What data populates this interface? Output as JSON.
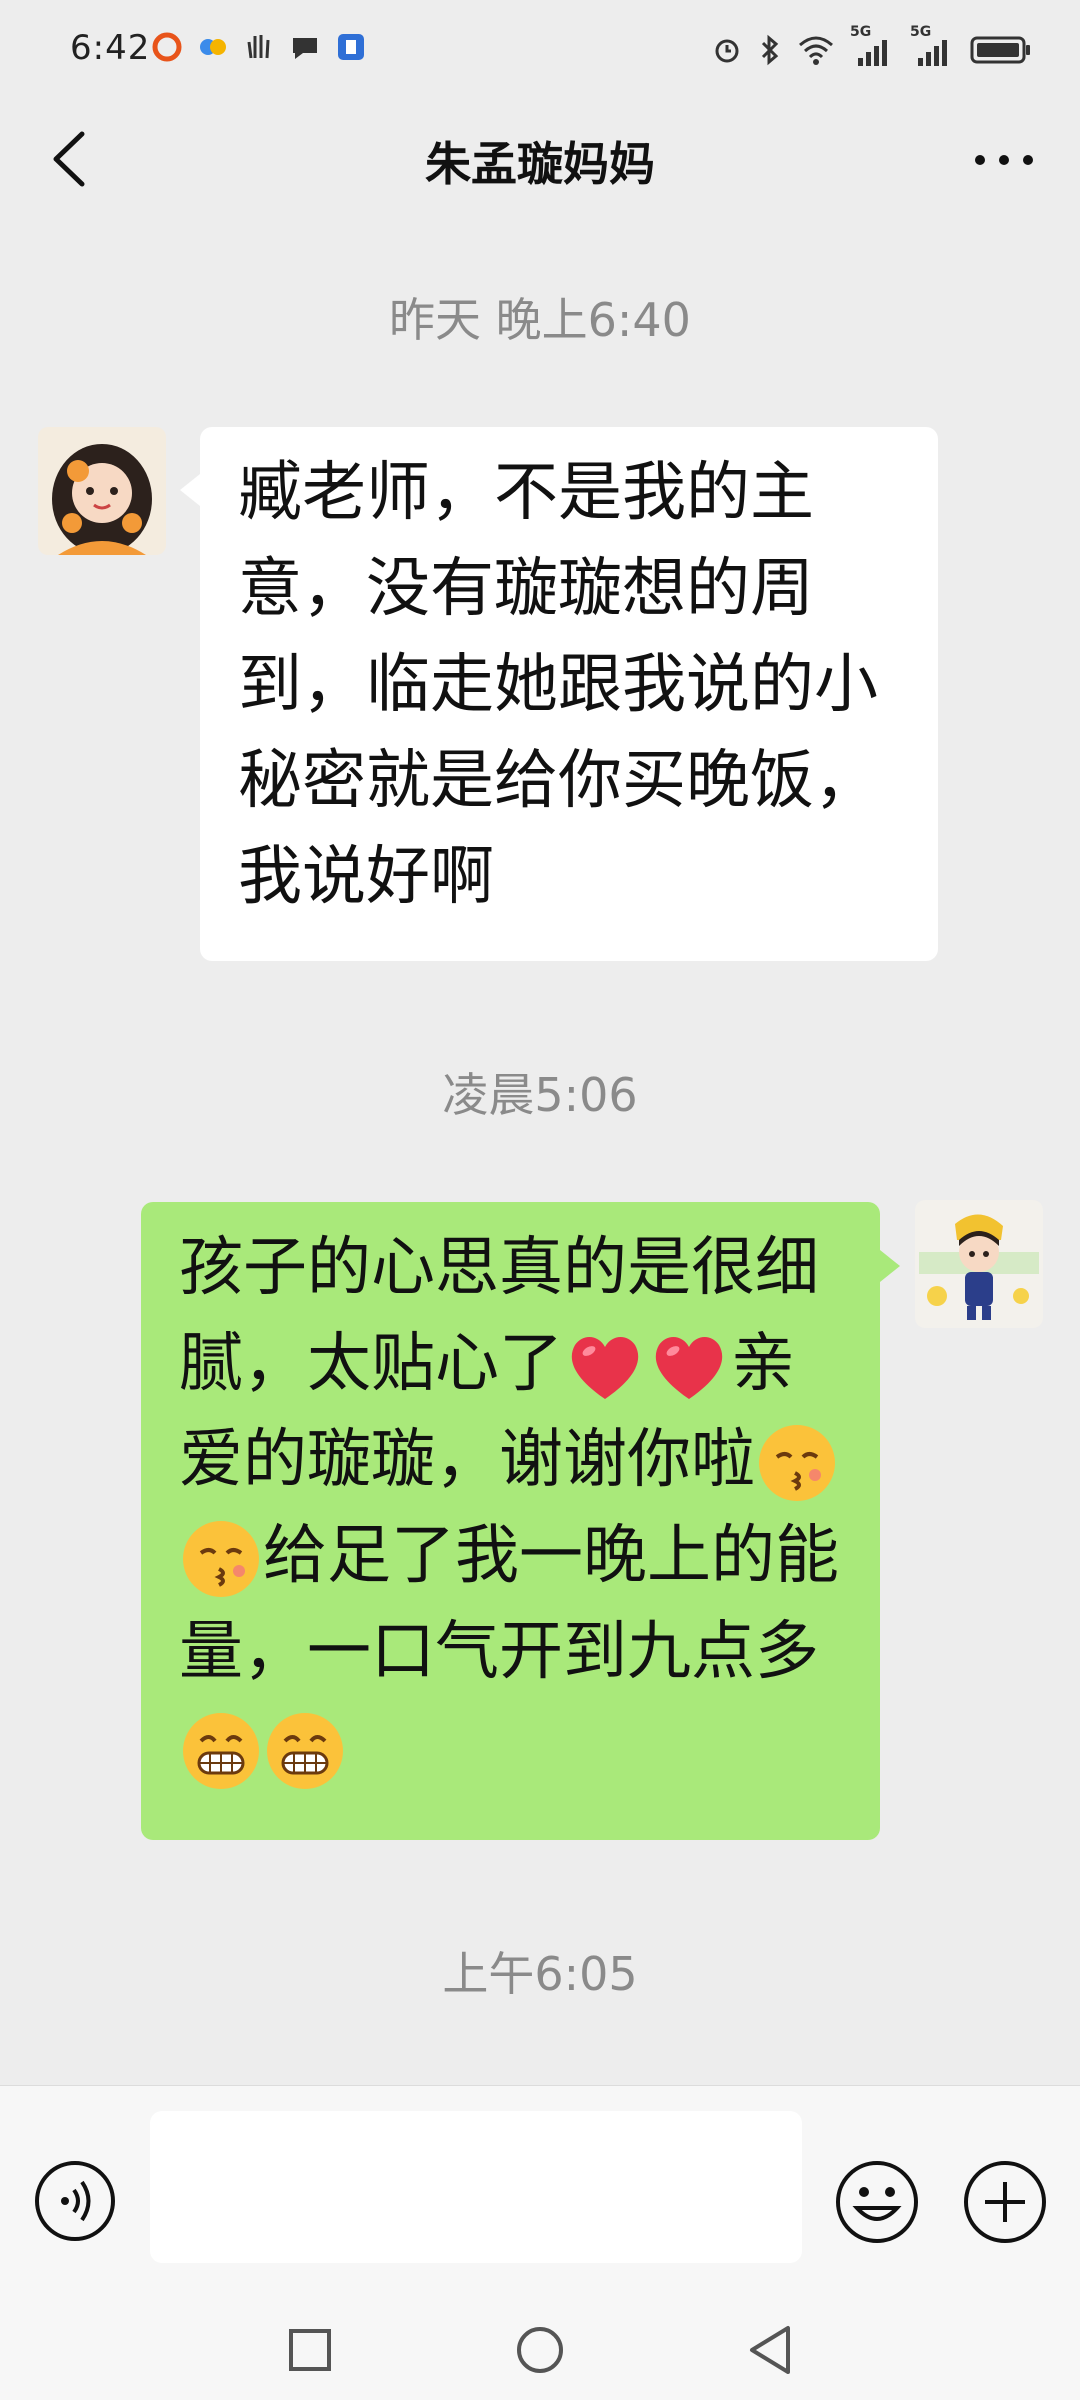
{
  "status_bar": {
    "time": "6:42",
    "network_1": "5G",
    "network_2": "5G"
  },
  "header": {
    "title": "朱孟璇妈妈"
  },
  "messages": [
    {
      "timestamp": "昨天 晚上6:40",
      "side": "left",
      "text": "臧老师，不是我的主意，没有璇璇想的周到，临走她跟我说的小秘密就是给你买晚饭，我说好啊"
    },
    {
      "timestamp": "凌晨5:06",
      "side": "right",
      "segments": [
        "孩子的心思真的是很细腻，太贴心了",
        "亲爱的璇璇，谢谢你啦",
        "给足了我一晚上的能量，一口气开到九点多"
      ],
      "emojis": [
        "heart-emoji",
        "kiss-emoji",
        "grin-emoji"
      ]
    },
    {
      "timestamp": "上午6:05"
    }
  ],
  "input_bar": {
    "placeholder": "",
    "voice_icon": "voice-icon",
    "emoji_icon": "emoji-icon",
    "plus_icon": "plus-icon"
  },
  "colors": {
    "background": "#ededed",
    "bubble_right": "#a9e97a",
    "bubble_left": "#ffffff",
    "timestamp": "#8a8a8a"
  }
}
